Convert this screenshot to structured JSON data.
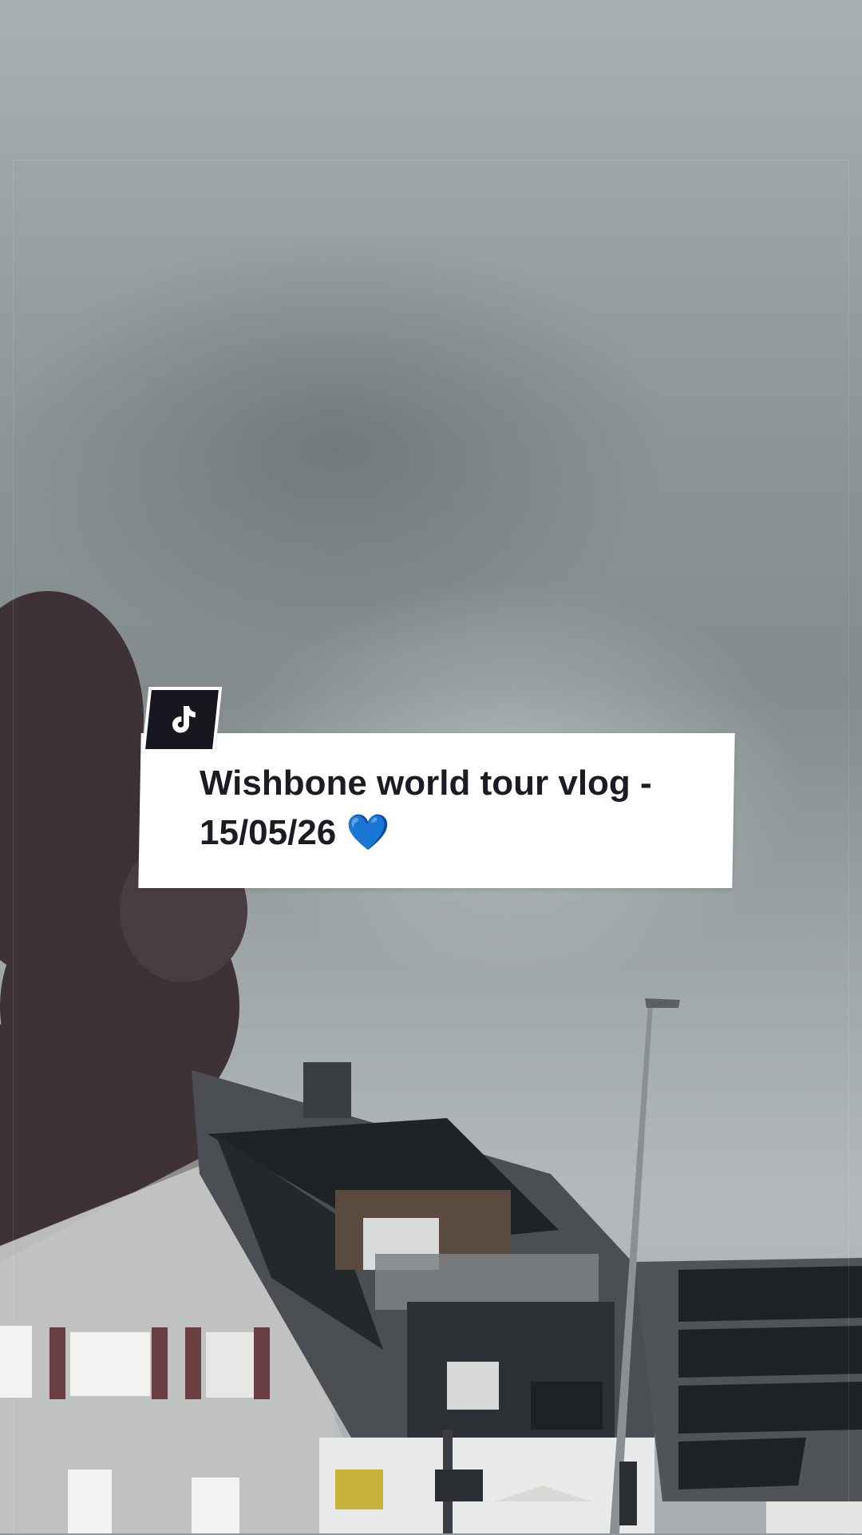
{
  "overlay": {
    "caption": "Wishbone world tour vlog -\n15/05/26 💙",
    "badge_icon": "tiktok-note-icon"
  },
  "colors": {
    "card_bg": "#ffffff",
    "badge_bg": "#16171f",
    "caption_text": "#1c1c24"
  }
}
